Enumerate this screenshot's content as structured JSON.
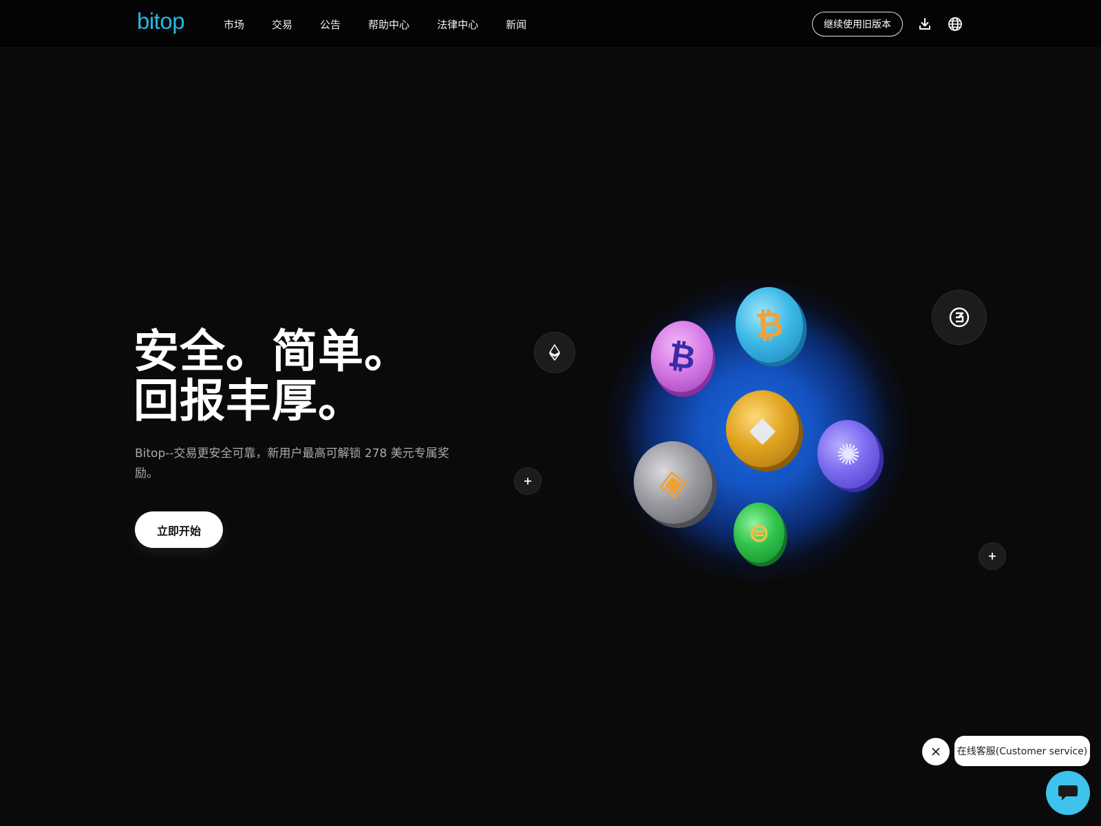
{
  "header": {
    "logo": "bitop",
    "nav": [
      {
        "label": "市场"
      },
      {
        "label": "交易"
      },
      {
        "label": "公告"
      },
      {
        "label": "帮助中心"
      },
      {
        "label": "法律中心"
      },
      {
        "label": "新闻"
      }
    ],
    "legacy_button": "继续使用旧版本",
    "icons": [
      "download-icon",
      "globe-icon"
    ]
  },
  "hero": {
    "title_line1": "安全。简单。",
    "title_line2": "回报丰厚。",
    "subtitle": "Bitop--交易更安全可靠，新用户最高可解锁 278 美元专属奖励。",
    "cta": "立即开始"
  },
  "illustration": {
    "glow_color": "#1a6ae0",
    "coins": [
      {
        "name": "bitcoin-pink-coin",
        "symbol": "₿",
        "color": "#d77ce6"
      },
      {
        "name": "bitcoin-blue-coin",
        "symbol": "₿",
        "color": "#3cb9e6"
      },
      {
        "name": "ethereum-gold-coin",
        "symbol": "◆",
        "color": "#e0a421"
      },
      {
        "name": "cardano-purple-coin",
        "symbol": "✺",
        "color": "#7b6bf0"
      },
      {
        "name": "bnb-silver-coin",
        "symbol": "◈",
        "color": "#9a9aa0"
      },
      {
        "name": "stellar-green-coin",
        "symbol": "⊜",
        "color": "#2fc24a"
      }
    ],
    "float_icons": [
      "ethereum-icon",
      "plus-icon",
      "token-three-icon",
      "plus-icon"
    ]
  },
  "chat": {
    "label": "在线客服(Customer service)",
    "accent": "#3ec3ec"
  }
}
